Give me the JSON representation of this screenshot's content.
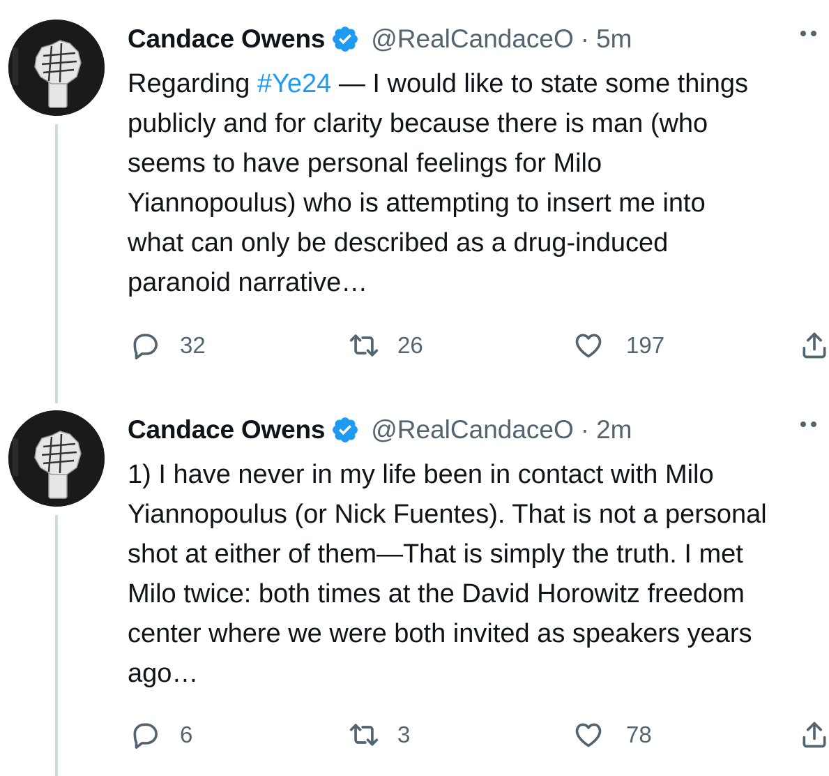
{
  "colors": {
    "link": "#1d9bf0",
    "secondary_text": "#536471",
    "primary_text": "#0f1419",
    "thread_line": "#cfd9de"
  },
  "tweets": [
    {
      "author_name": "Candace Owens",
      "verified_icon": "verified-badge-icon",
      "handle": "@RealCandaceO",
      "separator": "·",
      "time": "5m",
      "lines": [
        {
          "before": "Regarding ",
          "hashtag": "#Ye24",
          "after": " — I would like to state some things"
        },
        {
          "text": "publicly and for clarity because there is man (who"
        },
        {
          "text": "seems to have personal feelings for Milo"
        },
        {
          "text": "Yiannopoulus) who is attempting to insert me into"
        },
        {
          "text": "what can only be described as a drug-induced"
        },
        {
          "text": "paranoid narrative…"
        }
      ],
      "replies": "32",
      "retweets": "26",
      "likes": "197"
    },
    {
      "author_name": "Candace Owens",
      "verified_icon": "verified-badge-icon",
      "handle": "@RealCandaceO",
      "separator": "·",
      "time": "2m",
      "lines": [
        {
          "text": "1) I have never in my life been in contact with Milo"
        },
        {
          "text": "Yiannopoulus (or Nick Fuentes). That is not a personal"
        },
        {
          "text": "shot at either of them—That is simply the truth. I met"
        },
        {
          "text": "Milo twice: both times at the David Horowitz freedom"
        },
        {
          "text": "center where we were both invited as speakers years"
        },
        {
          "text": "ago…"
        }
      ],
      "replies": "6",
      "retweets": "3",
      "likes": "78"
    }
  ]
}
